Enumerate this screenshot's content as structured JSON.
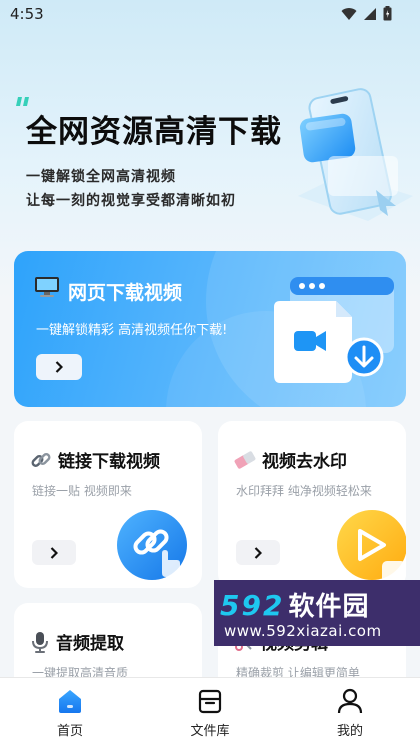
{
  "status_bar": {
    "time": "4:53"
  },
  "hero": {
    "title": "全网资源高清下载",
    "subtitle_1": "一键解锁全网高清视频",
    "subtitle_2": "让每一刻的视觉享受都清晰如初"
  },
  "banner": {
    "title": "网页下载视频",
    "description": "一键解锁精彩 高清视频任你下载!"
  },
  "cards": [
    {
      "title": "链接下载视频",
      "description": "链接一贴 视频即来"
    },
    {
      "title": "视频去水印",
      "description": "水印拜拜 纯净视频轻松来"
    },
    {
      "title": "音频提取",
      "description": "一键提取高清音质"
    },
    {
      "title": "视频剪辑",
      "description": "精确裁剪 让编辑更简单"
    }
  ],
  "watermark": {
    "brand_num": "592",
    "brand_text": "软件园",
    "url": "www.592xiazai.com"
  },
  "bottom_nav": [
    {
      "label": "首页",
      "active": true
    },
    {
      "label": "文件库",
      "active": false
    },
    {
      "label": "我的",
      "active": false
    }
  ],
  "colors": {
    "accent": "#1f8ef8",
    "banner_start": "#2ea3fb",
    "card_bg": "#ffffff",
    "muted_text": "#9aa0a8",
    "watermark_bg": "#3d2e6b"
  }
}
